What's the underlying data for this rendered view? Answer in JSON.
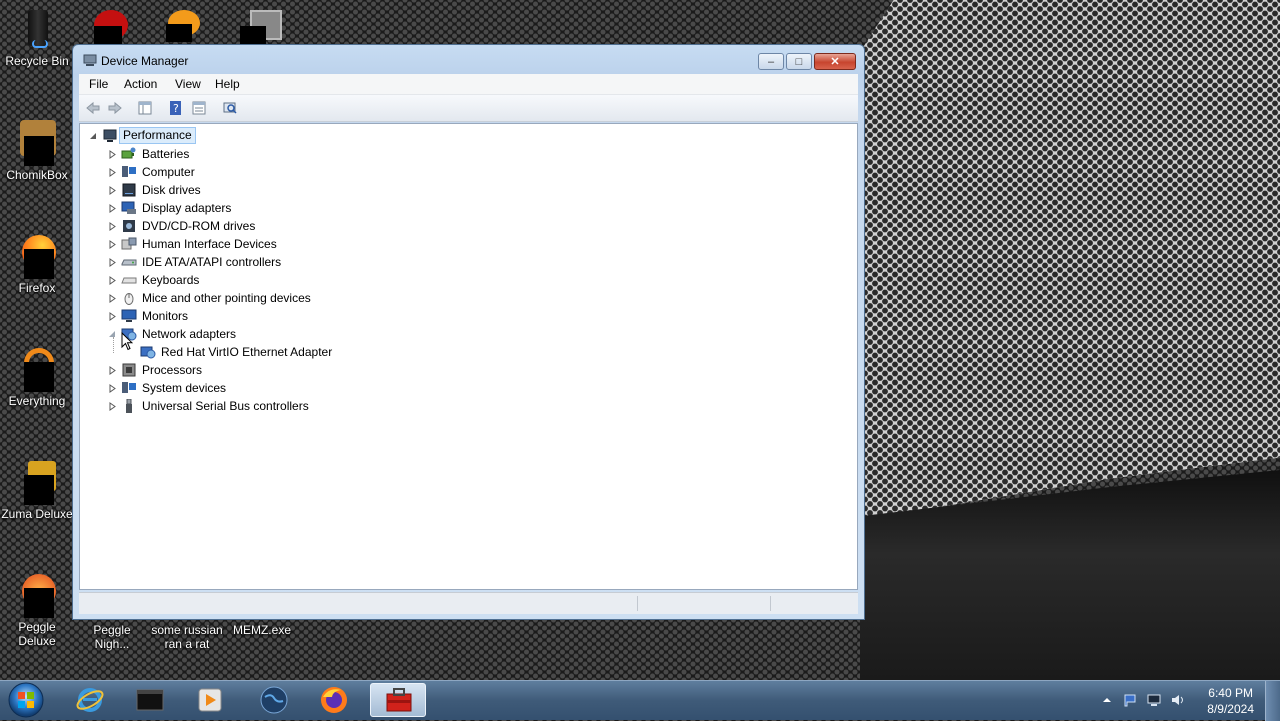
{
  "desktop": {
    "icons": [
      {
        "label": "Recycle Bin"
      },
      {
        "label": "ChomikBox"
      },
      {
        "label": "Firefox"
      },
      {
        "label": "Everything"
      },
      {
        "label": "Zuma Deluxe"
      },
      {
        "label": "Peggle Deluxe"
      },
      {
        "label": "Peggle Nigh..."
      },
      {
        "label": "some russian ran a rat"
      },
      {
        "label": "MEMZ.exe"
      }
    ]
  },
  "window": {
    "title": "Device Manager",
    "controls": {
      "minimize": "–",
      "maximize": "□",
      "close": "✕"
    },
    "menu": [
      "File",
      "Action",
      "View",
      "Help"
    ]
  },
  "tree": {
    "root": "Performance",
    "categories": [
      {
        "label": "Batteries",
        "icon": "battery-icon"
      },
      {
        "label": "Computer",
        "icon": "computer-icon"
      },
      {
        "label": "Disk drives",
        "icon": "disk-drive-icon"
      },
      {
        "label": "Display adapters",
        "icon": "display-adapter-icon"
      },
      {
        "label": "DVD/CD-ROM drives",
        "icon": "dvd-drive-icon"
      },
      {
        "label": "Human Interface Devices",
        "icon": "hid-icon"
      },
      {
        "label": "IDE ATA/ATAPI controllers",
        "icon": "ide-controller-icon"
      },
      {
        "label": "Keyboards",
        "icon": "keyboard-icon"
      },
      {
        "label": "Mice and other pointing devices",
        "icon": "mouse-icon"
      },
      {
        "label": "Monitors",
        "icon": "monitor-icon"
      },
      {
        "label": "Network adapters",
        "icon": "network-adapter-icon",
        "expanded": true,
        "children": [
          {
            "label": "Red Hat VirtIO Ethernet Adapter",
            "icon": "network-adapter-icon"
          }
        ]
      },
      {
        "label": "Processors",
        "icon": "processor-icon"
      },
      {
        "label": "System devices",
        "icon": "system-device-icon"
      },
      {
        "label": "Universal Serial Bus controllers",
        "icon": "usb-icon"
      }
    ]
  },
  "taskbar": {
    "clock_time": "6:40 PM",
    "clock_date": "8/9/2024",
    "apps": [
      "internet-explorer",
      "terminal",
      "media-player",
      "globe",
      "firefox",
      "device-manager"
    ]
  },
  "colors": {
    "accent": "#3f5b79",
    "selection": "#cce8ff",
    "titlebar": "#c7dcf2"
  }
}
